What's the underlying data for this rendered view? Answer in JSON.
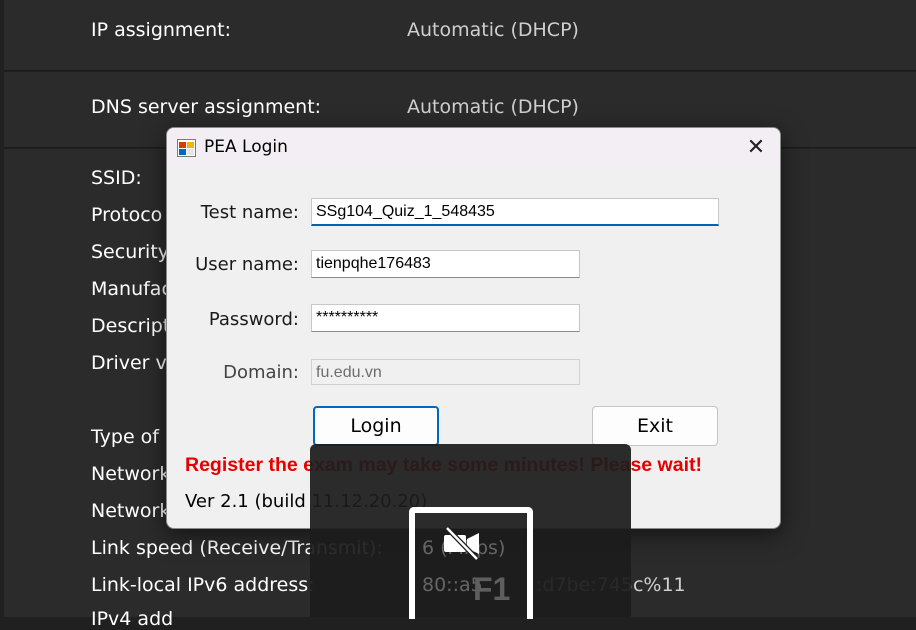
{
  "settings": {
    "ip_assignment_label": "IP assignment:",
    "ip_assignment_value": "Automatic (DHCP)",
    "dns_assignment_label": "DNS server assignment:",
    "dns_assignment_value": "Automatic (DHCP)",
    "props": [
      "SSID:",
      "Protoco",
      "Security",
      "Manufac",
      "Descript",
      "Driver ve"
    ],
    "props2": [
      "Type of",
      "Network",
      "Network"
    ],
    "link_speed_label": "Link speed (Receive/Transmit):",
    "link_local_label": "Link-local IPv6 address:",
    "ipv4_partial": "IPv4 add",
    "link_speed_value_partial": "6 (Mbps)",
    "link_local_value_partial": "80::a5",
    "link_local_value_partial2": ":d7be:745c%11"
  },
  "dialog": {
    "title": "PEA Login",
    "close_label": "✕",
    "test_name_label": "Test name:",
    "test_name_value": "SSg104_Quiz_1_548435",
    "user_name_label": "User name:",
    "user_name_value": "tienpqhe176483",
    "password_label": "Password:",
    "password_value": "**********",
    "domain_label": "Domain:",
    "domain_value": "fu.edu.vn",
    "login_label": "Login",
    "exit_label": "Exit",
    "warning": "Register the exam may take some minutes! Please wait!",
    "version": "Ver 2.1 (build 11.12.20.20)"
  },
  "overlay": {
    "key_label": "F1",
    "icon": "camera-off-icon"
  },
  "colors": {
    "background": "#202020",
    "warning": "#e60000",
    "accent": "#0067c0"
  }
}
